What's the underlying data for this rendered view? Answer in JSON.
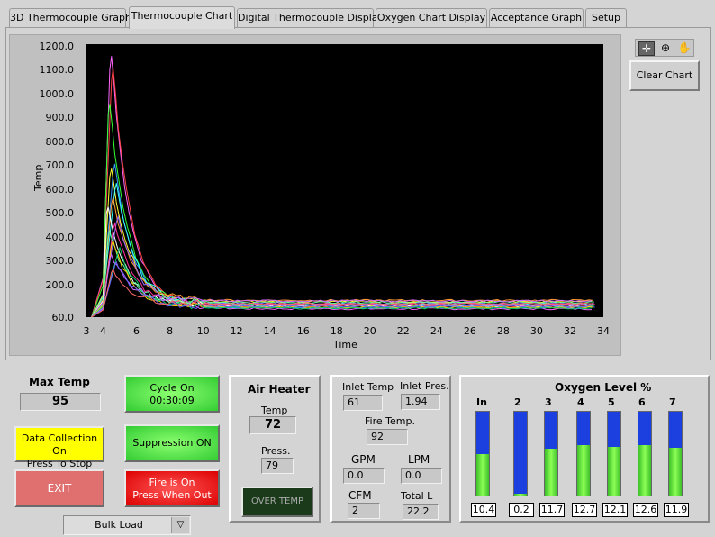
{
  "tabs": [
    "3D Thermocouple Graph",
    "Thermocouple Chart",
    "Digital Thermocouple Display",
    "Oxygen Chart Display",
    "Acceptance Graph",
    "Setup"
  ],
  "active_tab": "Thermocouple Chart",
  "chart_tools": {
    "clear_label": "Clear Chart"
  },
  "chart_data": {
    "type": "line",
    "ylabel": "Temp",
    "xlabel": "Time",
    "xlim": [
      3,
      34
    ],
    "ylim": [
      60,
      1200
    ],
    "yticks": [
      "1200.0",
      "1100.0",
      "1000.0",
      "900.0",
      "800.0",
      "700.0",
      "600.0",
      "500.0",
      "400.0",
      "300.0",
      "200.0",
      "60.0"
    ],
    "xticks": [
      "3",
      "4",
      "6",
      "8",
      "10",
      "12",
      "14",
      "16",
      "18",
      "20",
      "22",
      "24",
      "26",
      "28",
      "30",
      "32",
      "34"
    ],
    "background": "#000000",
    "series_colors": [
      "#ff66ff",
      "#ff4444",
      "#33ff33",
      "#3399ff",
      "#ffff33",
      "#33ffff",
      "#ff9933",
      "#ffffff",
      "#9966ff",
      "#ff3399",
      "#66ff99",
      "#ffcc00",
      "#00cc66",
      "#cc66ff",
      "#6666ff",
      "#ff6666"
    ],
    "peaks": [
      1150,
      1100,
      950,
      700,
      680,
      620,
      560,
      520,
      480,
      450,
      420,
      380,
      350,
      320,
      290,
      260
    ],
    "peak_x": [
      4.5,
      4.6,
      4.4,
      4.7,
      4.5,
      4.8,
      4.6,
      4.3,
      4.9,
      4.7,
      4.4,
      4.6,
      5.0,
      4.5,
      4.8,
      4.6
    ],
    "tail_level": [
      95,
      105,
      110,
      100,
      125,
      115,
      130,
      108,
      118,
      112,
      122,
      102,
      98,
      128,
      106,
      116
    ],
    "end_x": 33.5
  },
  "max_temp": {
    "label": "Max Temp",
    "value": "95"
  },
  "buttons": {
    "data_collection": "Data Collection On\nPress To Stop",
    "exit": "EXIT",
    "cycle_on": "Cycle On\n00:30:09",
    "suppression": "Suppression ON",
    "fire": "Fire is On\nPress When Out"
  },
  "dropdown": {
    "value": "Bulk Load"
  },
  "air_heater": {
    "title": "Air Heater",
    "temp_label": "Temp",
    "temp_value": "72",
    "press_label": "Press.",
    "press_value": "79",
    "over_temp": "OVER TEMP"
  },
  "inlet": {
    "inlet_temp_label": "Inlet Temp",
    "inlet_temp_value": "61",
    "inlet_pres_label": "Inlet Pres.",
    "inlet_pres_value": "1.94",
    "fire_temp_label": "Fire Temp.",
    "fire_temp_value": "92",
    "gpm_label": "GPM",
    "gpm_value": "0.0",
    "lpm_label": "LPM",
    "lpm_value": "0.0",
    "cfm_label": "CFM",
    "cfm_value": "2",
    "total_l_label": "Total L",
    "total_l_value": "22.2"
  },
  "oxygen": {
    "title": "Oxygen Level %",
    "scale_max": 21,
    "channels": [
      {
        "label": "In",
        "value": "10.4",
        "level": 10.4
      },
      {
        "label": "2",
        "value": "0.2",
        "level": 0.2
      },
      {
        "label": "3",
        "value": "11.7",
        "level": 11.7
      },
      {
        "label": "4",
        "value": "12.7",
        "level": 12.7
      },
      {
        "label": "5",
        "value": "12.1",
        "level": 12.1
      },
      {
        "label": "6",
        "value": "12.6",
        "level": 12.6
      },
      {
        "label": "7",
        "value": "11.9",
        "level": 11.9
      }
    ]
  },
  "colors": {
    "led_green": "#33dd33",
    "led_yellow": "#ffff00",
    "led_red": "#ee1111",
    "exit_red": "#e07070",
    "over_temp": "#1a3a1a",
    "bar_blue": "#1c3fe0",
    "bar_green": "#5bea3c"
  }
}
